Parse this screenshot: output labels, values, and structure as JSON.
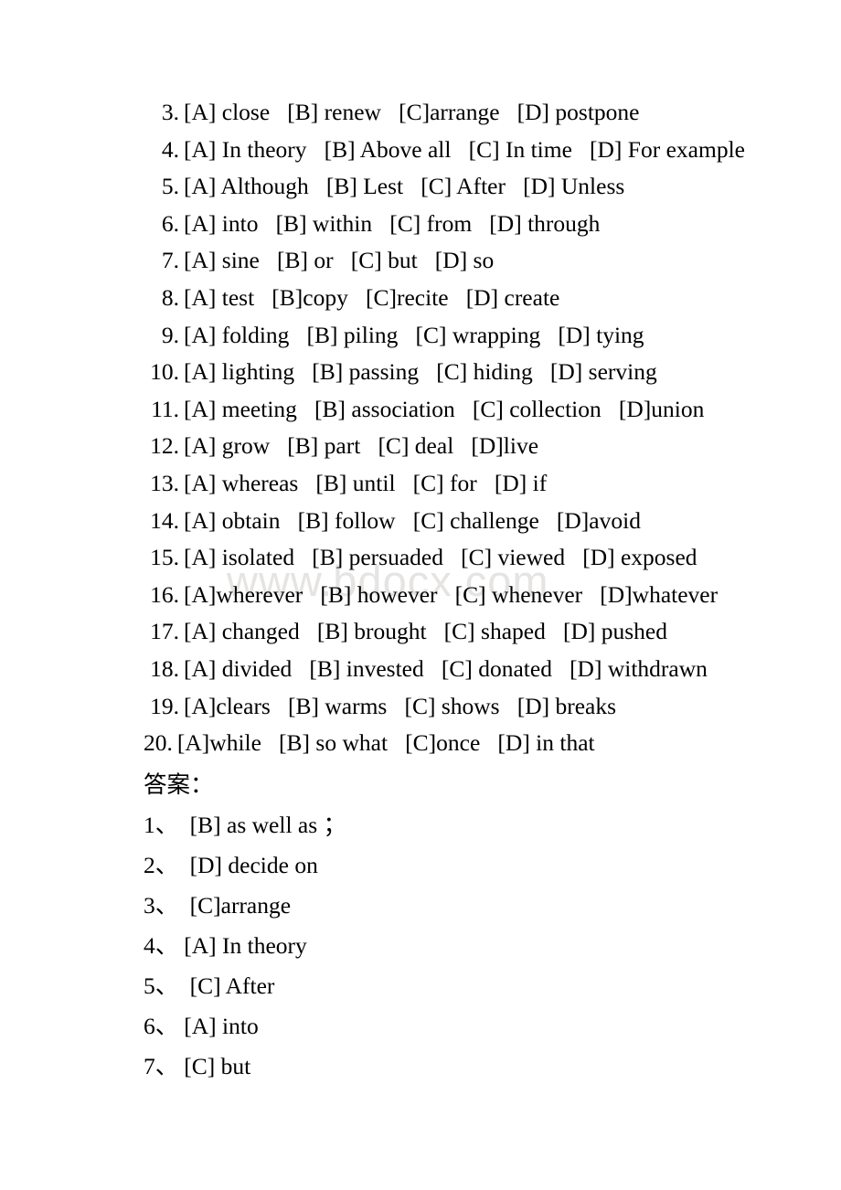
{
  "document": {
    "background_color": "#ffffff",
    "text_color": "#000000"
  },
  "watermark": {
    "text": "www.bdocx.com",
    "color": "#e6e4e2"
  },
  "questions": [
    {
      "number": "3.",
      "options": "[A] close   [B] renew   [C]arrange   [D] postpone"
    },
    {
      "number": "4.",
      "options": "[A] In theory   [B] Above all   [C] In time   [D] For example"
    },
    {
      "number": "5.",
      "options": "[A] Although   [B] Lest   [C] After   [D] Unless"
    },
    {
      "number": "6.",
      "options": "[A] into   [B] within   [C] from   [D] through"
    },
    {
      "number": "7.",
      "options": "[A] sine   [B] or   [C] but   [D] so"
    },
    {
      "number": "8.",
      "options": "[A] test   [B]copy   [C]recite   [D] create"
    },
    {
      "number": "9.",
      "options": "[A] folding   [B] piling   [C] wrapping   [D] tying"
    },
    {
      "number": "10.",
      "options": "[A] lighting   [B] passing   [C] hiding   [D] serving"
    },
    {
      "number": "11.",
      "options": "[A] meeting   [B] association   [C] collection   [D]union"
    },
    {
      "number": "12.",
      "options": "[A] grow   [B] part   [C] deal   [D]live"
    },
    {
      "number": "13.",
      "options": "[A] whereas   [B] until   [C] for   [D] if"
    },
    {
      "number": "14.",
      "options": "[A] obtain   [B] follow   [C] challenge   [D]avoid"
    },
    {
      "number": "15.",
      "options": "[A] isolated   [B] persuaded   [C] viewed   [D] exposed"
    },
    {
      "number": "16.",
      "options": "[A]wherever   [B] however   [C] whenever   [D]whatever"
    },
    {
      "number": "17.",
      "options": "[A] changed   [B] brought   [C] shaped   [D] pushed"
    },
    {
      "number": "18.",
      "options": "[A] divided   [B] invested   [C] donated   [D] withdrawn"
    },
    {
      "number": "19.",
      "options": "[A]clears   [B] warms   [C] shows   [D] breaks"
    },
    {
      "number": "20.",
      "options": "[A]while   [B] so what   [C]once   [D] in that"
    }
  ],
  "answers_section": {
    "heading": "答案：",
    "items": [
      {
        "number": "1、",
        "text": " [B] as well as ；"
      },
      {
        "number": "2、",
        "text": " [D] decide on"
      },
      {
        "number": "3、",
        "text": " [C]arrange"
      },
      {
        "number": "4、",
        "text": "[A] In theory"
      },
      {
        "number": "5、",
        "text": " [C] After"
      },
      {
        "number": "6、",
        "text": "[A] into"
      },
      {
        "number": "7、",
        "text": "[C] but"
      }
    ]
  }
}
